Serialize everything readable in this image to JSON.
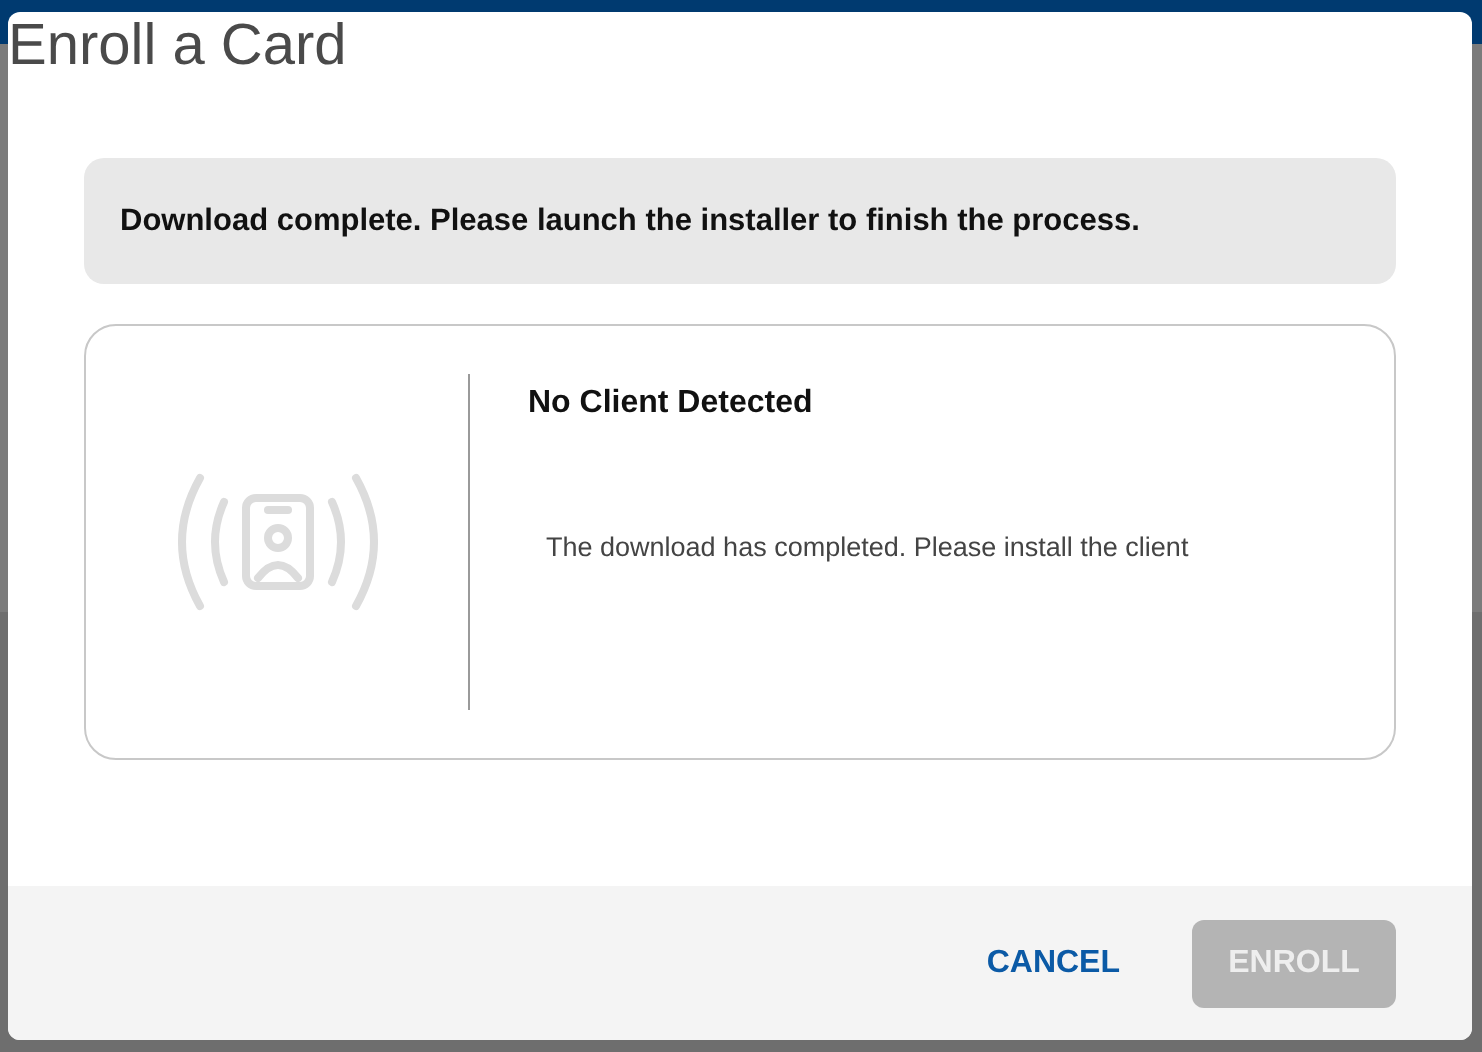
{
  "dialog": {
    "title": "Enroll a Card",
    "alert": "Download complete. Please launch the installer to finish the process.",
    "client_panel": {
      "heading": "No Client Detected",
      "message": "The download has completed. Please install the client"
    },
    "buttons": [
      {
        "label": "CANCEL",
        "kind": "text",
        "disabled": false
      },
      {
        "label": "ENROLL",
        "kind": "filled",
        "disabled": true
      }
    ]
  }
}
